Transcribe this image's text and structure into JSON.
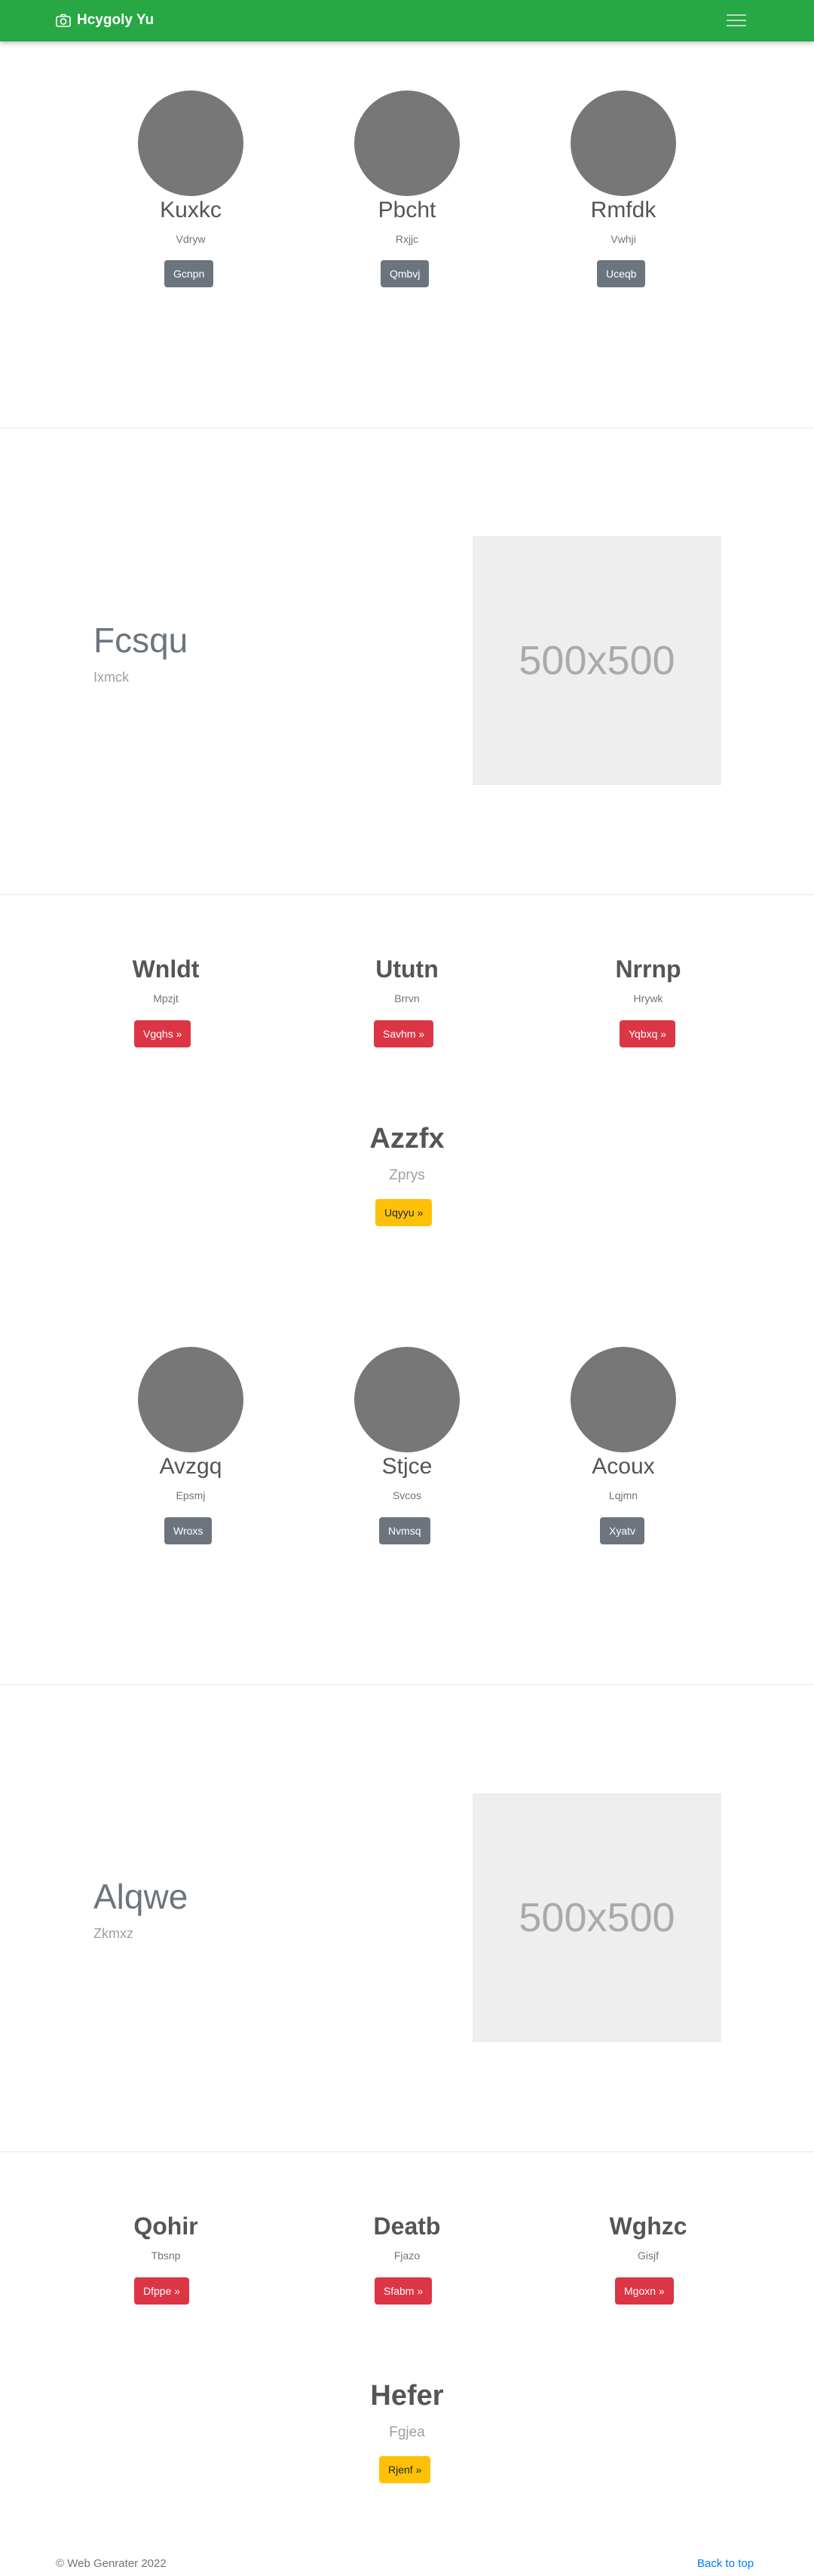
{
  "navbar": {
    "brand": "Hcygoly Yu",
    "bg": "#28a745"
  },
  "team1": [
    {
      "name": "Kuxkc",
      "role": "Vdryw",
      "button": "Gcnpn"
    },
    {
      "name": "Pbcht",
      "role": "Rxjjc",
      "button": "Qmbvj"
    },
    {
      "name": "Rmfdk",
      "role": "Vwhji",
      "button": "Uceqb"
    }
  ],
  "feature1": {
    "title": "Fcsqu",
    "subtitle": "Ixmck",
    "image_label": "500x500"
  },
  "cards1": [
    {
      "title": "Wnldt",
      "text": "Mpzjt",
      "button": "Vgqhs »"
    },
    {
      "title": "Ututn",
      "text": "Brrvn",
      "button": "Savhm »"
    },
    {
      "title": "Nrrnp",
      "text": "Hrywk",
      "button": "Yqbxq »"
    }
  ],
  "highlight1": {
    "title": "Azzfx",
    "subtitle": "Zprys",
    "button": "Uqyyu »"
  },
  "team2": [
    {
      "name": "Avzgq",
      "role": "Epsmj",
      "button": "Wroxs"
    },
    {
      "name": "Stjce",
      "role": "Svcos",
      "button": "Nvmsq"
    },
    {
      "name": "Acoux",
      "role": "Lqjmn",
      "button": "Xyatv"
    }
  ],
  "feature2": {
    "title": "Alqwe",
    "subtitle": "Zkmxz",
    "image_label": "500x500"
  },
  "cards2": [
    {
      "title": "Qohir",
      "text": "Tbsnp",
      "button": "Dfppe »"
    },
    {
      "title": "Deatb",
      "text": "Fjazo",
      "button": "Sfabm »"
    },
    {
      "title": "Wghzc",
      "text": "Gisjf",
      "button": "Mgoxn »"
    }
  ],
  "highlight2": {
    "title": "Hefer",
    "subtitle": "Fgjea",
    "button": "Rjenf »"
  },
  "footer": {
    "copyright": "© Web Genrater 2022",
    "back_to_top": "Back to top"
  }
}
